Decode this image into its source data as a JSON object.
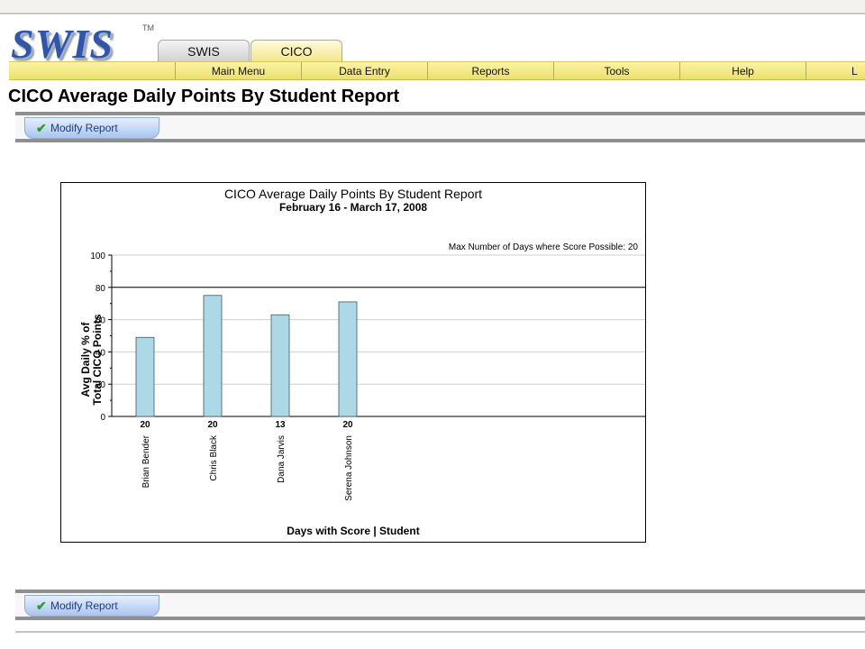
{
  "app": {
    "logo_text": "SWIS",
    "logo_tm": "TM"
  },
  "tabs": [
    {
      "label": "SWIS",
      "active": false
    },
    {
      "label": "CICO",
      "active": true
    }
  ],
  "nav": {
    "items": [
      "Main Menu",
      "Data Entry",
      "Reports",
      "Tools",
      "Help",
      "L"
    ]
  },
  "page": {
    "title": "CICO Average Daily Points By Student Report"
  },
  "toolbar": {
    "modify_label": "Modify Report",
    "check_icon": "checkmark-icon"
  },
  "chart_data": {
    "type": "bar",
    "title": "CICO Average Daily Points By Student Report",
    "subtitle": "February 16 - March 17, 2008",
    "note": "Max Number of Days where Score Possible: 20",
    "ylabel_line1": "Avg Daily % of",
    "ylabel_line2": "Total CICO Points",
    "xlabel": "Days with Score | Student",
    "categories": [
      "Brian Bender",
      "Chris Black",
      "Dana Jarvis",
      "Serena Johnson"
    ],
    "days_with_score": [
      "20",
      "20",
      "13",
      "20"
    ],
    "values": [
      49,
      75,
      63,
      71
    ],
    "ylim": [
      0,
      100
    ],
    "yticks": [
      0,
      20,
      40,
      60,
      80,
      100
    ],
    "reference_line": 80,
    "bar_color": "#add8e6",
    "grid": true
  }
}
